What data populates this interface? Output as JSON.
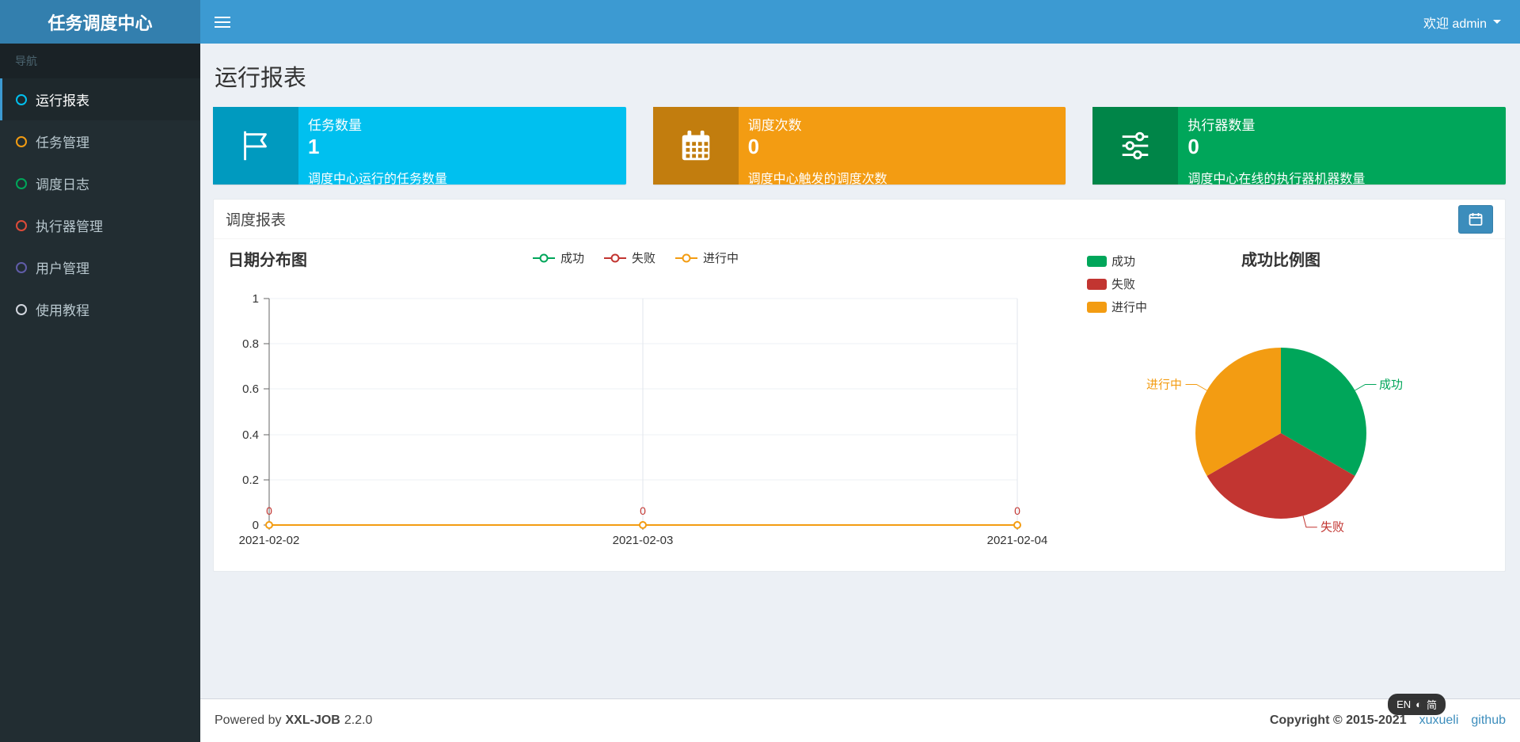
{
  "header": {
    "app_title": "任务调度中心",
    "welcome": "欢迎 admin"
  },
  "sidebar": {
    "section_label": "导航",
    "items": [
      {
        "label": "运行报表",
        "icon_color": "#00c0ef",
        "active": true
      },
      {
        "label": "任务管理",
        "icon_color": "#f39c12",
        "active": false
      },
      {
        "label": "调度日志",
        "icon_color": "#00a65a",
        "active": false
      },
      {
        "label": "执行器管理",
        "icon_color": "#dd4b39",
        "active": false
      },
      {
        "label": "用户管理",
        "icon_color": "#605ca8",
        "active": false
      },
      {
        "label": "使用教程",
        "icon_color": "#d2d6de",
        "active": false
      }
    ]
  },
  "page": {
    "title": "运行报表"
  },
  "stat_boxes": [
    {
      "label": "任务数量",
      "value": "1",
      "description": "调度中心运行的任务数量",
      "color": "#00c0ef",
      "icon": "flag-icon"
    },
    {
      "label": "调度次数",
      "value": "0",
      "description": "调度中心触发的调度次数",
      "color": "#f39c12",
      "icon": "calendar-icon"
    },
    {
      "label": "执行器数量",
      "value": "0",
      "description": "调度中心在线的执行器机器数量",
      "color": "#00a65a",
      "icon": "sliders-icon"
    }
  ],
  "report_panel": {
    "title": "调度报表"
  },
  "chart_data": [
    {
      "type": "line",
      "title": "日期分布图",
      "legend": [
        {
          "name": "成功",
          "color": "#00a65a"
        },
        {
          "name": "失败",
          "color": "#c23531"
        },
        {
          "name": "进行中",
          "color": "#f39c12"
        }
      ],
      "x": [
        "2021-02-02",
        "2021-02-03",
        "2021-02-04"
      ],
      "series": [
        {
          "name": "成功",
          "values": [
            0,
            0,
            0
          ]
        },
        {
          "name": "失败",
          "values": [
            0,
            0,
            0
          ]
        },
        {
          "name": "进行中",
          "values": [
            0,
            0,
            0
          ]
        }
      ],
      "ylim": [
        0,
        1
      ],
      "yticks": [
        "0",
        "0.2",
        "0.4",
        "0.6",
        "0.8",
        "1"
      ],
      "point_labels": [
        "0",
        "0",
        "0"
      ],
      "grid": true,
      "legend_position": "top-center"
    },
    {
      "type": "pie",
      "title": "成功比例图",
      "legend": [
        {
          "name": "成功",
          "color": "#00a65a"
        },
        {
          "name": "失败",
          "color": "#c23531"
        },
        {
          "name": "进行中",
          "color": "#f39c12"
        }
      ],
      "slices": [
        {
          "name": "成功",
          "fraction": 0.333,
          "color": "#00a65a"
        },
        {
          "name": "失败",
          "fraction": 0.333,
          "color": "#c23531"
        },
        {
          "name": "进行中",
          "fraction": 0.334,
          "color": "#f39c12"
        }
      ],
      "legend_position": "top-left"
    }
  ],
  "footer": {
    "powered_prefix": "Powered by",
    "brand": "XXL-JOB",
    "version": "2.2.0",
    "copyright": "Copyright © 2015-2021",
    "links": [
      {
        "label": "xuxueli"
      },
      {
        "label": "github"
      }
    ]
  },
  "ime_overlay": {
    "left": "EN",
    "middle": "◐",
    "right": "简"
  }
}
